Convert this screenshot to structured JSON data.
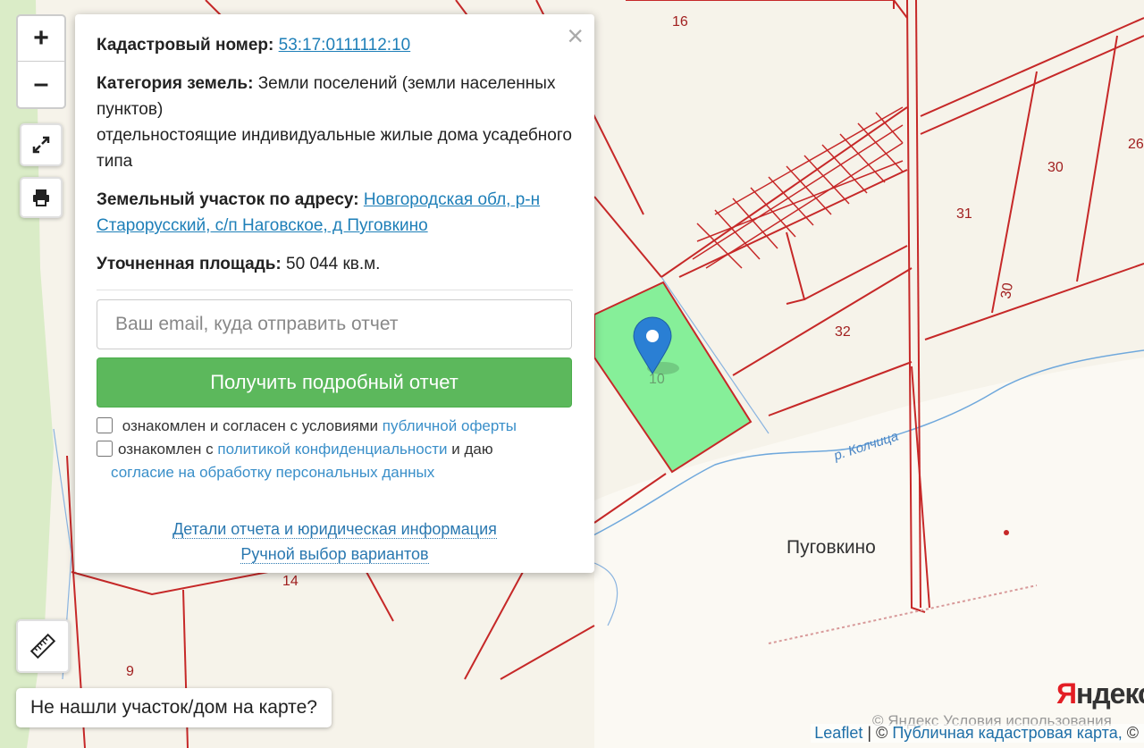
{
  "map": {
    "parcel_labels": [
      "16",
      "26",
      "30",
      "31",
      "30",
      "32",
      "10",
      "14",
      "9"
    ],
    "river_label": "р. Колчица",
    "village_label": "Пуговкино",
    "colors": {
      "boundary": "#c62828",
      "selected_parcel_fill": "#86ef99",
      "river": "#6fa8dc",
      "marker": "#2a7fd4",
      "background": "#f6f3ea",
      "water_edge": "#cfe4f5"
    }
  },
  "controls": {
    "zoom_in": "+",
    "zoom_out": "–",
    "fullscreen_icon": "expand-icon",
    "print_icon": "printer-icon",
    "ruler_icon": "ruler-icon"
  },
  "popup": {
    "close": "×",
    "cadastral_label": "Кадастровый номер:",
    "cadastral_value": "53:17:0111112:10",
    "category_label": "Категория земель:",
    "category_value": "Земли поселений (земли населенных пунктов)",
    "usage": "отдельностоящие индивидуальные жилые дома усадебного типа",
    "address_label": "Земельный участок по адресу:",
    "address_value": "Новгородская обл, р-н Старорусский, с/п Наговское, д Пуговкино",
    "area_label": "Уточненная площадь:",
    "area_value": "50 044 кв.м.",
    "email_placeholder": "Ваш email, куда отправить отчет",
    "submit_label": "Получить подробный отчет",
    "agree1_text": "ознакомлен и согласен с условиями",
    "agree1_link": "публичной оферты",
    "agree2_text": "ознакомлен с",
    "agree2_link": "политикой конфиденциальности",
    "agree2_mid": "и даю",
    "agree2_link2": "согласие на обработку персональных данных",
    "details_link": "Детали отчета и юридическая информация",
    "manual_link": "Ручной выбор вариантов"
  },
  "not_found_button": "Не нашли участок/дом на карте?",
  "attribution": {
    "leaflet": "Leaflet",
    "sep": "| ©",
    "cadastral_map": "Публичная кадастровая карта,",
    "copy": "©"
  },
  "yandex": {
    "logo_first": "Я",
    "logo_rest": "ндекс",
    "terms": "© Яндекс  Условия использования"
  }
}
